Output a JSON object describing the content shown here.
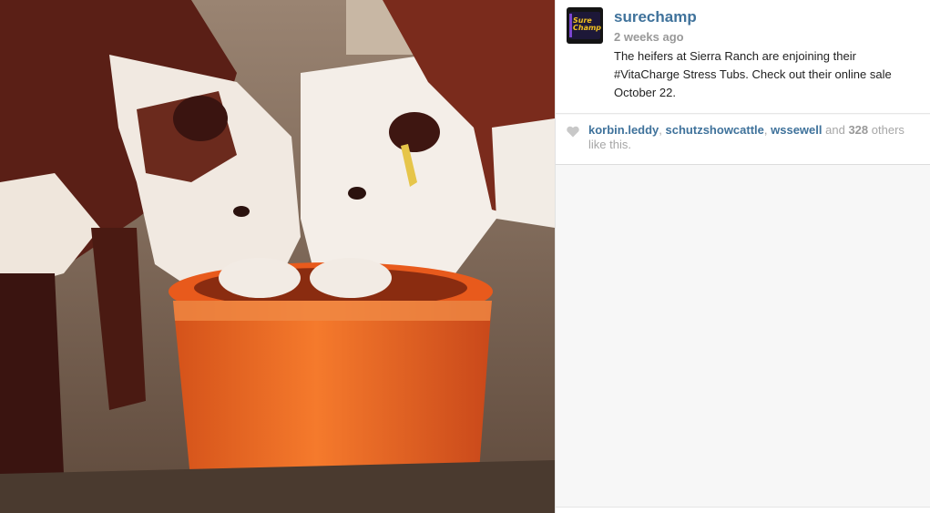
{
  "post": {
    "username": "surechamp",
    "timestamp": "2 weeks ago",
    "caption": "The heifers at Sierra Ranch are enjoining their #VitaCharge Stress Tubs. Check out their online sale October 22.",
    "avatar_text_line1": "Sure",
    "avatar_text_line2": "Champ"
  },
  "likes": {
    "users": [
      "korbin.leddy",
      "schutzshowcattle",
      "wssewell"
    ],
    "separator": ", ",
    "and": "and",
    "count": "328",
    "suffix": "others like this.",
    "icon": "heart-icon"
  },
  "photo": {
    "icon": "photo",
    "colors": {
      "tub": "#f26a1f",
      "ground": "#7a6352",
      "cow_brown": "#6a2418",
      "cow_white": "#f4eee8"
    }
  }
}
